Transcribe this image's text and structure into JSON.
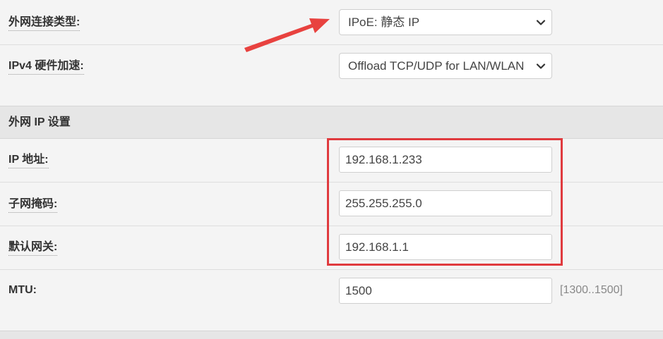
{
  "wan": {
    "connection_type": {
      "label": "外网连接类型:",
      "selected": "IPoE: 静态 IP"
    },
    "hw_accel": {
      "label": "IPv4 硬件加速:",
      "selected": "Offload TCP/UDP for LAN/WLAN"
    }
  },
  "ip_section": {
    "title": "外网 IP 设置",
    "ip_address": {
      "label": "IP 地址:",
      "value": "192.168.1.233"
    },
    "netmask": {
      "label": "子网掩码:",
      "value": "255.255.255.0"
    },
    "gateway": {
      "label": "默认网关:",
      "value": "192.168.1.1"
    },
    "mtu": {
      "label": "MTU:",
      "value": "1500",
      "hint": "[1300..1500]"
    }
  },
  "icons": {
    "dropdown": "chevron-down-icon",
    "annotation_arrow": "red-arrow-icon"
  },
  "colors": {
    "annotation": "#e03a3e",
    "section_bg": "#e6e6e6",
    "row_bg": "#f4f4f4"
  }
}
